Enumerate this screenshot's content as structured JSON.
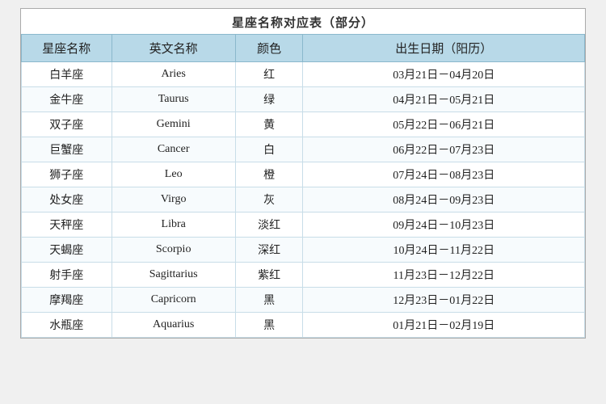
{
  "title": "星座名称对应表（部分）",
  "headers": {
    "name_cn": "星座名称",
    "name_en": "英文名称",
    "color": "颜色",
    "date": "出生日期（阳历）"
  },
  "rows": [
    {
      "name_cn": "白羊座",
      "name_en": "Aries",
      "color": "红",
      "date": "03月21日－04月20日"
    },
    {
      "name_cn": "金牛座",
      "name_en": "Taurus",
      "color": "绿",
      "date": "04月21日－05月21日"
    },
    {
      "name_cn": "双子座",
      "name_en": "Gemini",
      "color": "黄",
      "date": "05月22日－06月21日"
    },
    {
      "name_cn": "巨蟹座",
      "name_en": "Cancer",
      "color": "白",
      "date": "06月22日－07月23日"
    },
    {
      "name_cn": "狮子座",
      "name_en": "Leo",
      "color": "橙",
      "date": "07月24日－08月23日"
    },
    {
      "name_cn": "处女座",
      "name_en": "Virgo",
      "color": "灰",
      "date": "08月24日－09月23日"
    },
    {
      "name_cn": "天秤座",
      "name_en": "Libra",
      "color": "淡红",
      "date": "09月24日－10月23日"
    },
    {
      "name_cn": "天蝎座",
      "name_en": "Scorpio",
      "color": "深红",
      "date": "10月24日－11月22日"
    },
    {
      "name_cn": "射手座",
      "name_en": "Sagittarius",
      "color": "紫红",
      "date": "11月23日－12月22日"
    },
    {
      "name_cn": "摩羯座",
      "name_en": "Capricorn",
      "color": "黑",
      "date": "12月23日－01月22日"
    },
    {
      "name_cn": "水瓶座",
      "name_en": "Aquarius",
      "color": "黑",
      "date": "01月21日－02月19日"
    }
  ]
}
